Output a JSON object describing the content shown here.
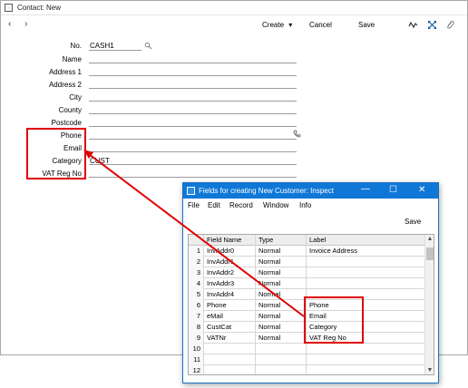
{
  "main_window": {
    "title": "Contact: New",
    "nav": {
      "prev": "‹",
      "next": "›"
    },
    "toolbar": {
      "create_label": "Create",
      "create_arrow": "▾",
      "cancel_label": "Cancel",
      "save_label": "Save"
    },
    "icons": [
      "activity-icon",
      "expand-icon",
      "attachment-icon"
    ],
    "fields": [
      {
        "label": "No.",
        "value": "CASH1"
      },
      {
        "label": "Name",
        "value": ""
      },
      {
        "label": "Address 1",
        "value": ""
      },
      {
        "label": "Address 2",
        "value": ""
      },
      {
        "label": "City",
        "value": ""
      },
      {
        "label": "County",
        "value": ""
      },
      {
        "label": "Postcode",
        "value": ""
      },
      {
        "label": "Phone",
        "value": ""
      },
      {
        "label": "Email",
        "value": ""
      },
      {
        "label": "Category",
        "value": "CUST"
      },
      {
        "label": "VAT Reg No",
        "value": ""
      }
    ]
  },
  "dialog": {
    "title": "Fields for creating New Customer: Inspect",
    "window_controls": {
      "minimize": "—",
      "maximize": "☐",
      "close": "✕"
    },
    "menu": [
      "File",
      "Edit",
      "Record",
      "Window",
      "Info"
    ],
    "save_label": "Save",
    "table": {
      "headers": [
        "",
        "Field Name",
        "Type",
        "Label"
      ],
      "rows": [
        {
          "num": "1",
          "field": "InvAddr0",
          "type": "Normal",
          "label": "Invoice Address"
        },
        {
          "num": "2",
          "field": "InvAddr1",
          "type": "Normal",
          "label": ""
        },
        {
          "num": "3",
          "field": "InvAddr2",
          "type": "Normal",
          "label": ""
        },
        {
          "num": "4",
          "field": "InvAddr3",
          "type": "Normal",
          "label": ""
        },
        {
          "num": "5",
          "field": "InvAddr4",
          "type": "Normal",
          "label": ""
        },
        {
          "num": "6",
          "field": "Phone",
          "type": "Normal",
          "label": "Phone"
        },
        {
          "num": "7",
          "field": "eMail",
          "type": "Normal",
          "label": "Email"
        },
        {
          "num": "8",
          "field": "CustCat",
          "type": "Normal",
          "label": "Category"
        },
        {
          "num": "9",
          "field": "VATNr",
          "type": "Normal",
          "label": "VAT Reg No"
        },
        {
          "num": "10",
          "field": "",
          "type": "",
          "label": ""
        },
        {
          "num": "11",
          "field": "",
          "type": "",
          "label": ""
        },
        {
          "num": "12",
          "field": "",
          "type": "",
          "label": ""
        }
      ]
    }
  },
  "colors": {
    "highlight": "#e00000",
    "dialog_titlebar": "#0f78d7"
  }
}
